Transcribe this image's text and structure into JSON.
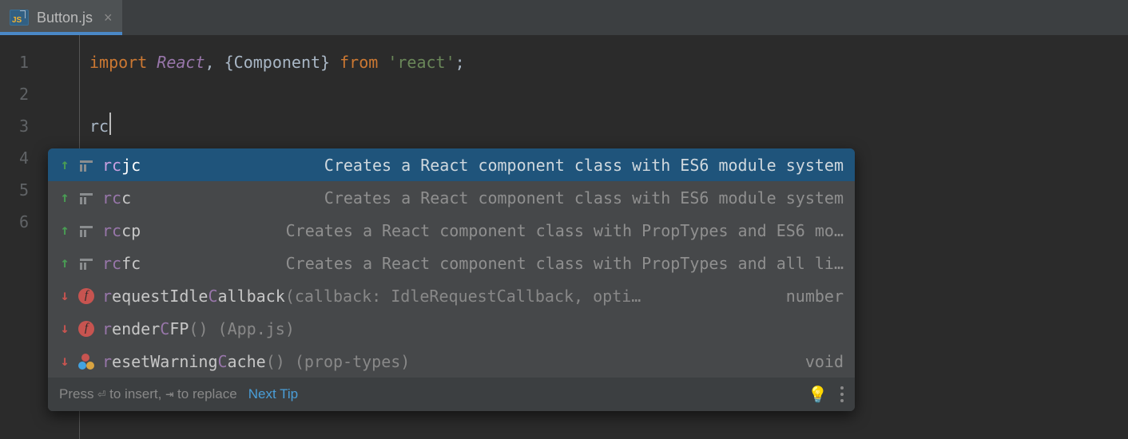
{
  "tab": {
    "filename": "Button.js",
    "close_glyph": "×"
  },
  "gutter": {
    "lines": [
      "1",
      "2",
      "3",
      "4",
      "5",
      "6"
    ]
  },
  "code": {
    "line1": {
      "import_kw": "import",
      "react_cls": "React",
      "comma": ",",
      "lbrace": " {",
      "component": "Component",
      "rbrace": "} ",
      "from_kw": "from",
      "react_str": "'react'",
      "semi": ";"
    },
    "typed": "rc"
  },
  "completion": {
    "items": [
      {
        "direction": "up",
        "icon": "template",
        "label_html": "<span class='hl'>rc</span>jc",
        "desc": "Creates a React component class with ES6 module system",
        "selected": true
      },
      {
        "direction": "up",
        "icon": "template",
        "label_html": "<span class='hl'>rc</span>c",
        "desc": "Creates a React component class with ES6 module system"
      },
      {
        "direction": "up",
        "icon": "template",
        "label_html": "<span class='hl'>rc</span>cp",
        "desc": "Creates a React component class with PropTypes and ES6 mo…"
      },
      {
        "direction": "up",
        "icon": "template",
        "label_html": "<span class='hl'>rc</span>fc",
        "desc": "Creates a React component class with PropTypes and all li…"
      },
      {
        "direction": "down",
        "icon": "function",
        "label_html": "<span class='hl'>r</span>equestIdle<span class='hl'>C</span>allback<span class='sig'>(callback: IdleRequestCallback, opti…</span>",
        "ret": "number"
      },
      {
        "direction": "down",
        "icon": "function",
        "label_html": "<span class='hl'>r</span>ender<span class='hl'>C</span>FP<span class='sig'>() (App.js)</span>"
      },
      {
        "direction": "down",
        "icon": "dots",
        "label_html": "<span class='hl'>r</span>esetWarning<span class='hl'>C</span>ache<span class='sig'>() (prop-types)</span>",
        "ret": "void"
      }
    ],
    "footer": {
      "hint_pre": "Press ",
      "enter_sym": "⏎",
      "hint_mid": " to insert, ",
      "tab_sym": "⇥",
      "hint_post": " to replace",
      "next_tip": "Next Tip"
    }
  }
}
